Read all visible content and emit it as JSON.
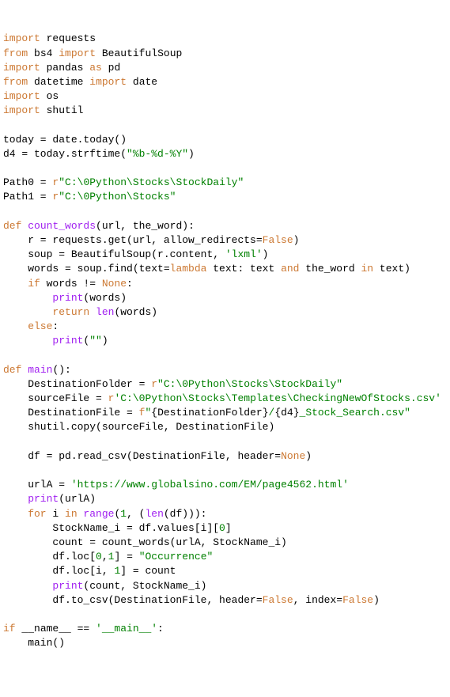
{
  "code": {
    "l01_import": "import",
    "l01_requests": "requests",
    "l02_from": "from",
    "l02_bs4": "bs4",
    "l02_import": "import",
    "l02_bsoup": "BeautifulSoup",
    "l03_import": "import",
    "l03_pandas": "pandas",
    "l03_as": "as",
    "l03_pd": "pd",
    "l04_from": "from",
    "l04_datetime": "datetime",
    "l04_import": "import",
    "l04_date": "date",
    "l05_import": "import",
    "l05_os": "os",
    "l06_import": "import",
    "l06_shutil": "shutil",
    "l08_today": "today = date.today()",
    "l09_d4_a": "d4 = today.strftime(",
    "l09_d4_str": "\"%b-%d-%Y\"",
    "l09_d4_b": ")",
    "l11_a": "Path0 = ",
    "l11_r": "r",
    "l11_str": "\"C:\\0Python\\Stocks\\StockDaily\"",
    "l12_a": "Path1 = ",
    "l12_r": "r",
    "l12_str": "\"C:\\0Python\\Stocks\"",
    "l14_def": "def",
    "l14_name": "count_words",
    "l14_params": "(url, the_word):",
    "l15_a": "    r = requests.get(url, allow_redirects=",
    "l15_false": "False",
    "l15_b": ")",
    "l16_a": "    soup = BeautifulSoup(r.content, ",
    "l16_str": "'lxml'",
    "l16_b": ")",
    "l17_a": "    words = soup.find(text=",
    "l17_lambda": "lambda",
    "l17_b": " text: text ",
    "l17_and": "and",
    "l17_c": " the_word ",
    "l17_in": "in",
    "l17_d": " text)",
    "l18_if": "    if",
    "l18_a": " words != ",
    "l18_none": "None",
    "l18_b": ":",
    "l19_print": "        print",
    "l19_a": "(words)",
    "l20_return": "        return",
    "l20_len": " len",
    "l20_a": "(words)",
    "l21_else": "    else",
    "l21_a": ":",
    "l22_print": "        print",
    "l22_a": "(",
    "l22_str": "\"\"",
    "l22_b": ")",
    "l24_def": "def",
    "l24_name": "main",
    "l24_a": "():",
    "l25_a": "    DestinationFolder = ",
    "l25_r": "r",
    "l25_str": "\"C:\\0Python\\Stocks\\StockDaily\"",
    "l26_a": "    sourceFile = ",
    "l26_r": "r",
    "l26_str": "'C:\\0Python\\Stocks\\Templates\\CheckingNewOfStocks.csv'",
    "l27_a": "    DestinationFile = ",
    "l27_f": "f",
    "l27_str1": "\"",
    "l27_br1": "{DestinationFolder}",
    "l27_str2": "/",
    "l27_br2": "{d4}",
    "l27_str3": "_Stock_Search.csv\"",
    "l28_a": "    shutil.copy(sourceFile, DestinationFile)",
    "l30_a": "    df = pd.read_csv(DestinationFile, header=",
    "l30_none": "None",
    "l30_b": ")",
    "l32_a": "    urlA = ",
    "l32_str": "'https://www.globalsino.com/EM/page4562.html'",
    "l33_print": "    print",
    "l33_a": "(urlA)",
    "l34_for": "    for",
    "l34_a": " i ",
    "l34_in": "in",
    "l34_range": " range",
    "l34_b": "(",
    "l34_n1": "1",
    "l34_c": ", (",
    "l34_len": "len",
    "l34_d": "(df))):",
    "l35_a": "        StockName_i = df.values[i][",
    "l35_n0": "0",
    "l35_b": "]",
    "l36_a": "        count = count_words(urlA, StockName_i)",
    "l37_a": "        df.loc[",
    "l37_n0": "0",
    "l37_b": ",",
    "l37_n1": "1",
    "l37_c": "] = ",
    "l37_str": "\"Occurrence\"",
    "l38_a": "        df.loc[i, ",
    "l38_n1": "1",
    "l38_b": "] = count",
    "l39_print": "        print",
    "l39_a": "(count, StockName_i)",
    "l40_a": "        df.to_csv(DestinationFile, header=",
    "l40_false1": "False",
    "l40_b": ", index=",
    "l40_false2": "False",
    "l40_c": ")",
    "l42_if": "if",
    "l42_a": " __name__ == ",
    "l42_str": "'__main__'",
    "l42_b": ":",
    "l43_a": "    main()"
  }
}
